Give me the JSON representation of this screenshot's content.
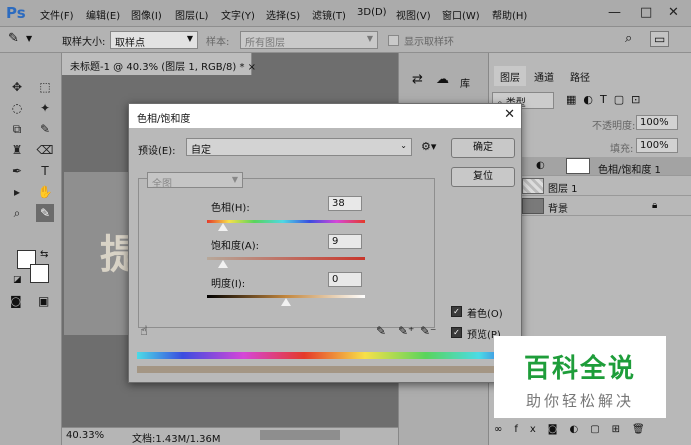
{
  "app": {
    "logo": "Ps"
  },
  "menu": [
    "文件(F)",
    "编辑(E)",
    "图像(I)",
    "图层(L)",
    "文字(Y)",
    "选择(S)",
    "滤镜(T)",
    "3D(D)",
    "视图(V)",
    "窗口(W)",
    "帮助(H)"
  ],
  "window_controls": {
    "minimize": "—",
    "restore": "□",
    "close": "✕"
  },
  "options": {
    "sample_size_label": "取样大小:",
    "sample_size_value": "取样点",
    "sample_label": "样本:",
    "sample_value": "所有图层",
    "show_ring_label": "显示取样环"
  },
  "document": {
    "tab_title": "未标题-1 @ 40.3% (图层 1, RGB/8) *",
    "tab_close": "×",
    "canvas_glyph": "提"
  },
  "status": {
    "zoom": "40.33%",
    "doc_info": "文档:1.43M/1.36M"
  },
  "panels": {
    "library_label": "库",
    "tabs": [
      "图层",
      "通道",
      "路径"
    ],
    "kind_label": "类型",
    "opacity_label": "不透明度:",
    "opacity_value": "100%",
    "fill_label": "填充:",
    "fill_value": "100%",
    "layers": [
      {
        "name": "色相/饱和度 1"
      },
      {
        "name": "图层 1"
      },
      {
        "name": "背景"
      }
    ]
  },
  "dialog": {
    "title": "色相/饱和度",
    "close": "✕",
    "preset_label": "预设(E):",
    "preset_value": "自定",
    "channel_value": "全图",
    "hue_label": "色相(H):",
    "hue_value": "38",
    "hue_position": 0.1,
    "saturation_label": "饱和度(A):",
    "saturation_value": "9",
    "saturation_position": 0.1,
    "lightness_label": "明度(I):",
    "lightness_value": "0",
    "lightness_position": 0.5,
    "ok_label": "确定",
    "reset_label": "复位",
    "colorize_label": "着色(O)",
    "colorize_checked": true,
    "preview_label": "预览(P)",
    "preview_checked": true
  },
  "watermark": {
    "title": "百科全说",
    "subtitle": "助你轻松解决",
    "color": "#1e9d3a"
  }
}
